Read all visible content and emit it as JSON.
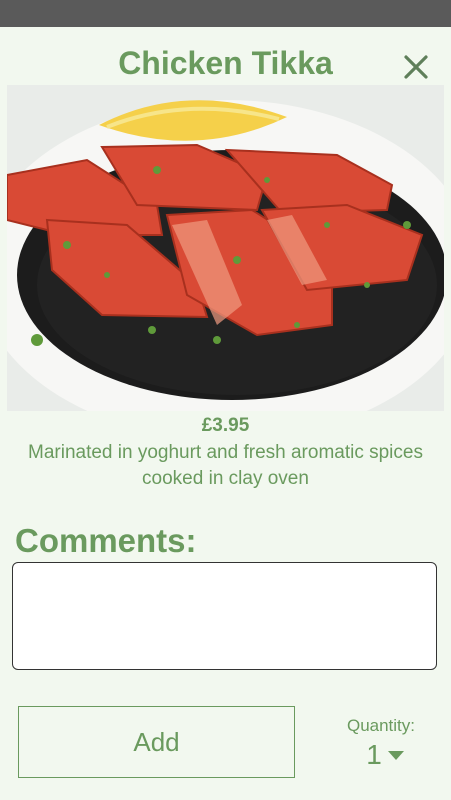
{
  "item": {
    "title": "Chicken Tikka",
    "price": "£3.95",
    "description": "Marinated in yoghurt and fresh aromatic spices cooked in clay oven",
    "image_icon": "chicken-tikka-photo"
  },
  "comments": {
    "label": "Comments:",
    "value": ""
  },
  "actions": {
    "add_label": "Add",
    "close_icon": "close-icon"
  },
  "quantity": {
    "label": "Quantity:",
    "value": "1"
  },
  "colors": {
    "accent": "#6a9a5e",
    "background": "#f2f8ef",
    "status_bar": "#5a5a5a"
  }
}
